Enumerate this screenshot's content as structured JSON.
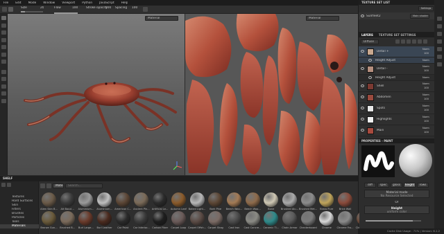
{
  "menu": [
    "File",
    "Edit",
    "Mode",
    "Window",
    "Viewport",
    "Python",
    "JavaScript",
    "Help"
  ],
  "toolbar": {
    "size_label": "Size",
    "size_value": "20",
    "flow_label": "Flow",
    "flow_value": "100",
    "stroke_label": "Stroke opacity",
    "stroke_value": "100",
    "spacing_label": "Spacing",
    "spacing_value": "100",
    "size_fill": 0.18,
    "flow_fill": 1.0,
    "stroke_fill": 1.0,
    "spacing_fill": 0.25,
    "extra_fill": 0.8
  },
  "viewport2d": {
    "mode_dropdown": "Material"
  },
  "viewport3d": {
    "mode_dropdown": "Material"
  },
  "texture_set_list": {
    "title": "TEXTURE SET LIST",
    "settings_btn": "Settings",
    "item_name": "Sunfleet2",
    "item_shader": "Main shader"
  },
  "layers": {
    "tab1": "LAYERS",
    "tab2": "TEXTURE SET SETTINGS",
    "channel": "Diffuse",
    "items": [
      {
        "name": "Detail +",
        "blend": "Norm",
        "opacity": "100",
        "sub": "Height Adjust",
        "sub_blend": "Norm",
        "thumb": "#c8a88f"
      },
      {
        "name": "Detail -",
        "blend": "Norm",
        "opacity": "100",
        "sub": "Height Adjust",
        "sub_blend": "Norm",
        "thumb": "#b58f7e"
      },
      {
        "name": "Shell",
        "blend": "Norm",
        "opacity": "100",
        "thumb": "#7b3a32"
      },
      {
        "name": "Abdomen",
        "blend": "Norm",
        "opacity": "100",
        "thumb": "#9a4a3e"
      },
      {
        "name": "Spots",
        "blend": "Norm",
        "opacity": "100",
        "thumb": "#e7e7e7"
      },
      {
        "name": "Highlights",
        "blend": "Norm",
        "opacity": "100",
        "thumb": "#f0f0f0"
      },
      {
        "name": "Main",
        "blend": "Norm",
        "opacity": "100",
        "thumb": "#a84a3e"
      }
    ]
  },
  "properties": {
    "title": "PROPERTIES - PAINT",
    "channels": [
      "diff",
      "spec",
      "gloss",
      "height",
      "rows"
    ],
    "active_channel": "height",
    "material_mode": "Material mode",
    "no_resource": "No Resource Selected",
    "or": "Or",
    "height_label": "Height",
    "uniform": "uniform color",
    "height_fill": 0.85
  },
  "shelf": {
    "title": "SHELF",
    "search_placeholder": "Search...",
    "filter_tag": "Materi",
    "categories": [
      "Textures",
      "Hard Surfaces",
      "Skin",
      "Filters",
      "Brushes",
      "Particles",
      "Tools",
      "Materials"
    ],
    "selected_category": "Materials",
    "materials_row1": [
      {
        "label": "Alien Skin B...",
        "c": "#6a5a48"
      },
      {
        "label": "Alt Boucl...",
        "c": "#3a3a3a"
      },
      {
        "label": "Aluminium...",
        "c": "#9a9a9a"
      },
      {
        "label": "Aluminium...",
        "c": "#bfbfbf"
      },
      {
        "label": "American C...",
        "c": "#5b4534"
      },
      {
        "label": "Ancient Pin...",
        "c": "#7a6a58"
      },
      {
        "label": "Artificial Le...",
        "c": "#2a2a2a"
      },
      {
        "label": "Autumn Leaf",
        "c": "#8a5a2a"
      },
      {
        "label": "Baked Light...",
        "c": "#b7b7b7"
      },
      {
        "label": "Bark Pine",
        "c": "#5c4634"
      },
      {
        "label": "Beech Woo...",
        "c": "#a37a54"
      },
      {
        "label": "Beech Woo...",
        "c": "#8e6a4a"
      },
      {
        "label": "Bone",
        "c": "#cfc8b4"
      },
      {
        "label": "Brushed Alu...",
        "c": "#aaaaaa"
      },
      {
        "label": "Brushed Met...",
        "c": "#8c8c8c"
      },
      {
        "label": "Brass Pure",
        "c": "#bfa45b"
      },
      {
        "label": "Brick Wall",
        "c": "#8a4a3a"
      }
    ],
    "materials_row2": [
      {
        "label": "Bronze Gun...",
        "c": "#6a5a3a"
      },
      {
        "label": "Brushed B...",
        "c": "#7a6a5a"
      },
      {
        "label": "Burl Large...",
        "c": "#6a3a2a"
      },
      {
        "label": "Burl Leather",
        "c": "#4a2a1e"
      },
      {
        "label": "Car Paint",
        "c": "#2a2a2a"
      },
      {
        "label": "Car Interior...",
        "c": "#3a3a3a"
      },
      {
        "label": "Carbon Fiber",
        "c": "#1e1e1e"
      },
      {
        "label": "Carpet Loop",
        "c": "#6a5a58"
      },
      {
        "label": "Carpet Offsh...",
        "c": "#5a4a44"
      },
      {
        "label": "Carpet Shag",
        "c": "#7a6a64"
      },
      {
        "label": "Cast Iron",
        "c": "#4a4a4a"
      },
      {
        "label": "Cast Concre...",
        "c": "#8a8a84"
      },
      {
        "label": "Ceramic Ti...",
        "c": "#2e8a8a"
      },
      {
        "label": "Chain Armor",
        "c": "#5a5a5a"
      },
      {
        "label": "Checkerboard",
        "c": "#7a7a7a"
      },
      {
        "label": "Chrome",
        "c": "#d8d8d8"
      },
      {
        "label": "Chrome Fro...",
        "c": "#8a8a8a"
      },
      {
        "label": "Climbing H...",
        "c": "#6a4a3a"
      },
      {
        "label": "Coated Metal",
        "c": "#6a6a6a"
      }
    ]
  },
  "status": "Cache Disk Usage : 71% | Version: 6.1.2"
}
